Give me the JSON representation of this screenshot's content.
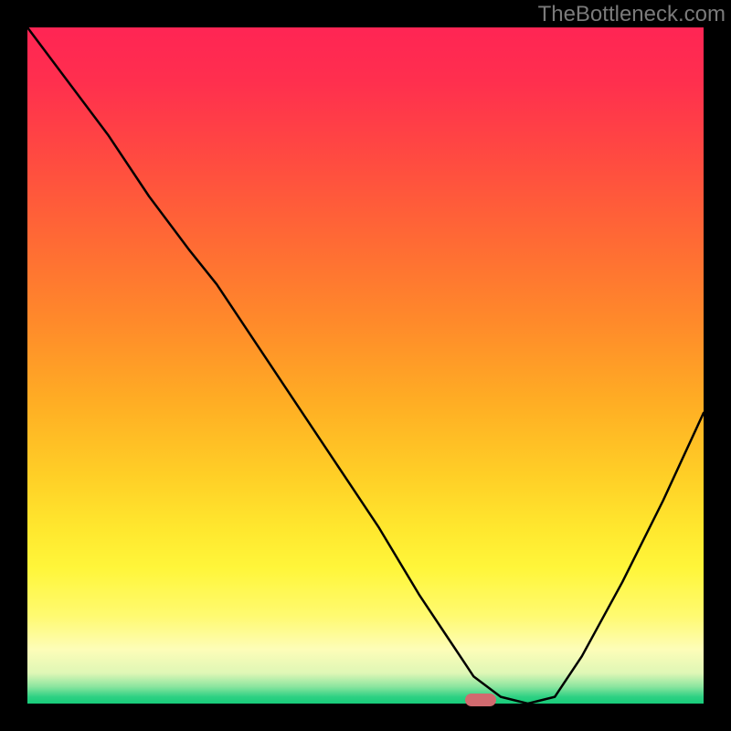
{
  "watermark": "TheBottleneck.com",
  "chart_data": {
    "type": "line",
    "title": "",
    "xlabel": "",
    "ylabel": "",
    "xlim": [
      0,
      100
    ],
    "ylim": [
      0,
      100
    ],
    "series": [
      {
        "name": "curve",
        "x": [
          0,
          6,
          12,
          18,
          24,
          28,
          34,
          40,
          46,
          52,
          58,
          62,
          66,
          70,
          74,
          78,
          82,
          88,
          94,
          100
        ],
        "y": [
          100,
          92,
          84,
          75,
          67,
          62,
          53,
          44,
          35,
          26,
          16,
          10,
          4,
          1,
          0,
          1,
          7,
          18,
          30,
          43
        ]
      }
    ],
    "marker": {
      "x": 67,
      "y": 0.5
    },
    "gradient_stops": [
      {
        "pct": 0,
        "color": "#ff2554"
      },
      {
        "pct": 50,
        "color": "#ff9e27"
      },
      {
        "pct": 80,
        "color": "#fff63a"
      },
      {
        "pct": 100,
        "color": "#17cc7a"
      }
    ]
  }
}
